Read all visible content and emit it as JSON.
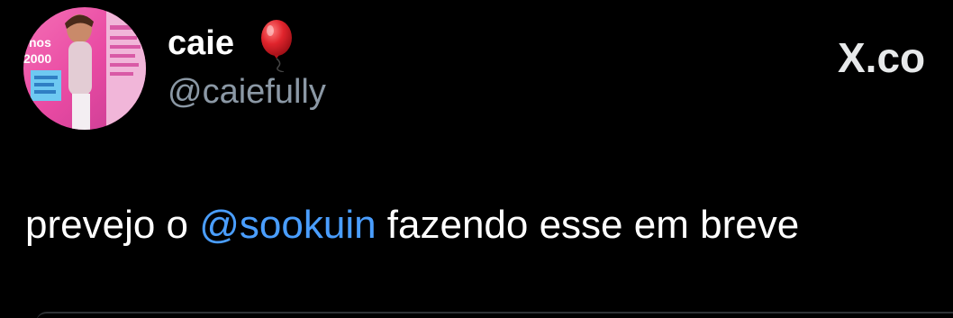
{
  "author": {
    "display_name": "caie",
    "handle": "@caiefully",
    "name_emoji": "balloon-emoji",
    "avatar_text": [
      "nos",
      "2000"
    ]
  },
  "brand": {
    "logo_text": "X.co",
    "logo_icon": "x-logo-icon"
  },
  "tweet": {
    "text_before": "prevejo o ",
    "mention": "@sookuin",
    "text_after": " fazendo esse em breve"
  },
  "colors": {
    "background": "#000000",
    "text": "#ffffff",
    "handle": "#8b98a5",
    "mention": "#4a9eff",
    "balloon": "#e0242c"
  }
}
